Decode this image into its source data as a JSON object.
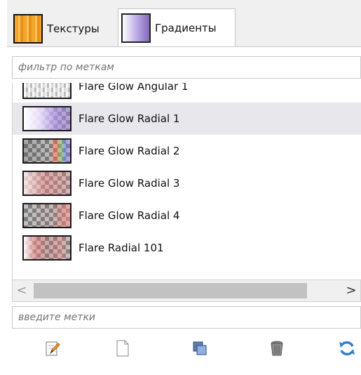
{
  "tabs": [
    {
      "label": "Текстуры",
      "active": false
    },
    {
      "label": "Градиенты",
      "active": true
    }
  ],
  "filter": {
    "placeholder": "фильтр по меткам"
  },
  "gradients": [
    {
      "name": "Flare Glow Angular 1",
      "selected": false
    },
    {
      "name": "Flare Glow Radial 1",
      "selected": true
    },
    {
      "name": "Flare Glow Radial 2",
      "selected": false
    },
    {
      "name": "Flare Glow Radial 3",
      "selected": false
    },
    {
      "name": "Flare Glow Radial 4",
      "selected": false
    },
    {
      "name": "Flare Radial 101",
      "selected": false
    }
  ],
  "scrollbar": {
    "left_arrow": "<",
    "right_arrow": ">"
  },
  "tags": {
    "placeholder": "введите метки"
  },
  "toolbar": {
    "buttons": [
      {
        "icon": "edit-icon"
      },
      {
        "icon": "new-document-icon"
      },
      {
        "icon": "duplicate-icon"
      },
      {
        "icon": "trash-icon"
      },
      {
        "icon": "refresh-icon"
      }
    ]
  },
  "colors": {
    "selection": "#e8e8ec",
    "texture_orange": "#f4a52a",
    "gradient_purple": "#b9a7e6"
  }
}
